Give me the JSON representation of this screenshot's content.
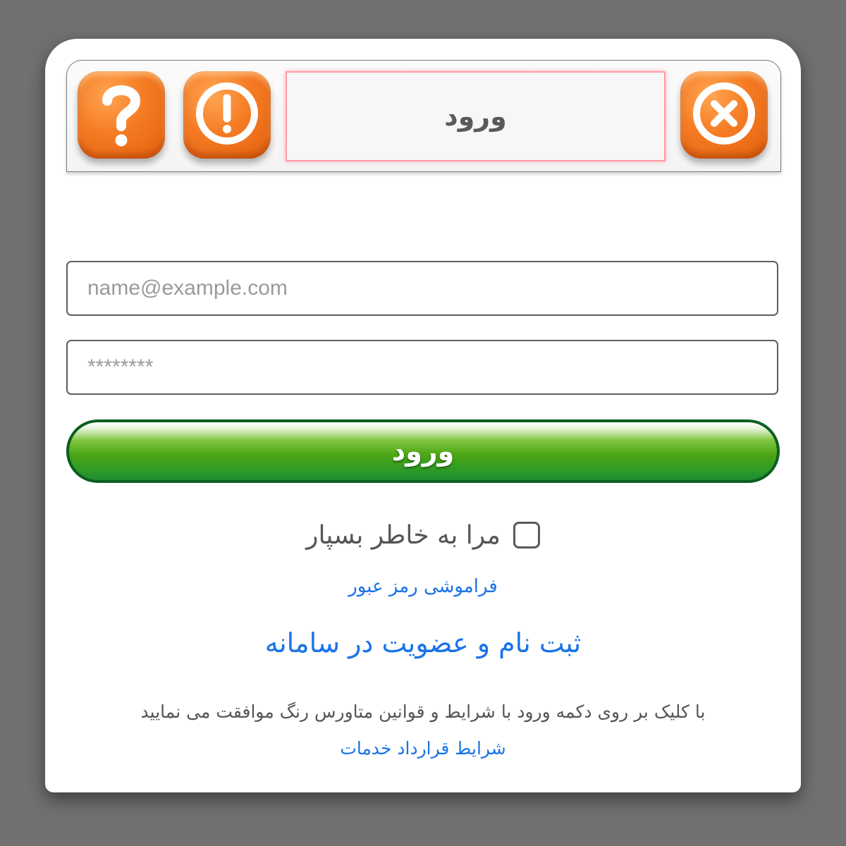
{
  "header": {
    "title": "ورود",
    "help_icon": "question-mark-icon",
    "info_icon": "exclamation-icon",
    "close_icon": "close-x-icon",
    "accent_color": "#f57b23"
  },
  "form": {
    "email_placeholder": "name@example.com",
    "email_value": "",
    "password_placeholder": "********",
    "password_value": "",
    "login_label": "ورود",
    "login_color": "#4aa414"
  },
  "remember": {
    "label": "مرا به خاطر بسپار",
    "checked": false
  },
  "links": {
    "forgot_password": "فراموشی رمز عبور",
    "register": "ثبت نام و عضویت در سامانه",
    "link_color": "#1a73e8"
  },
  "terms": {
    "text": "با کلیک بر روی دکمه ورود با شرایط و قوانین متاورس رنگ موافقت می نمایید",
    "link": "شرایط قرارداد خدمات"
  }
}
